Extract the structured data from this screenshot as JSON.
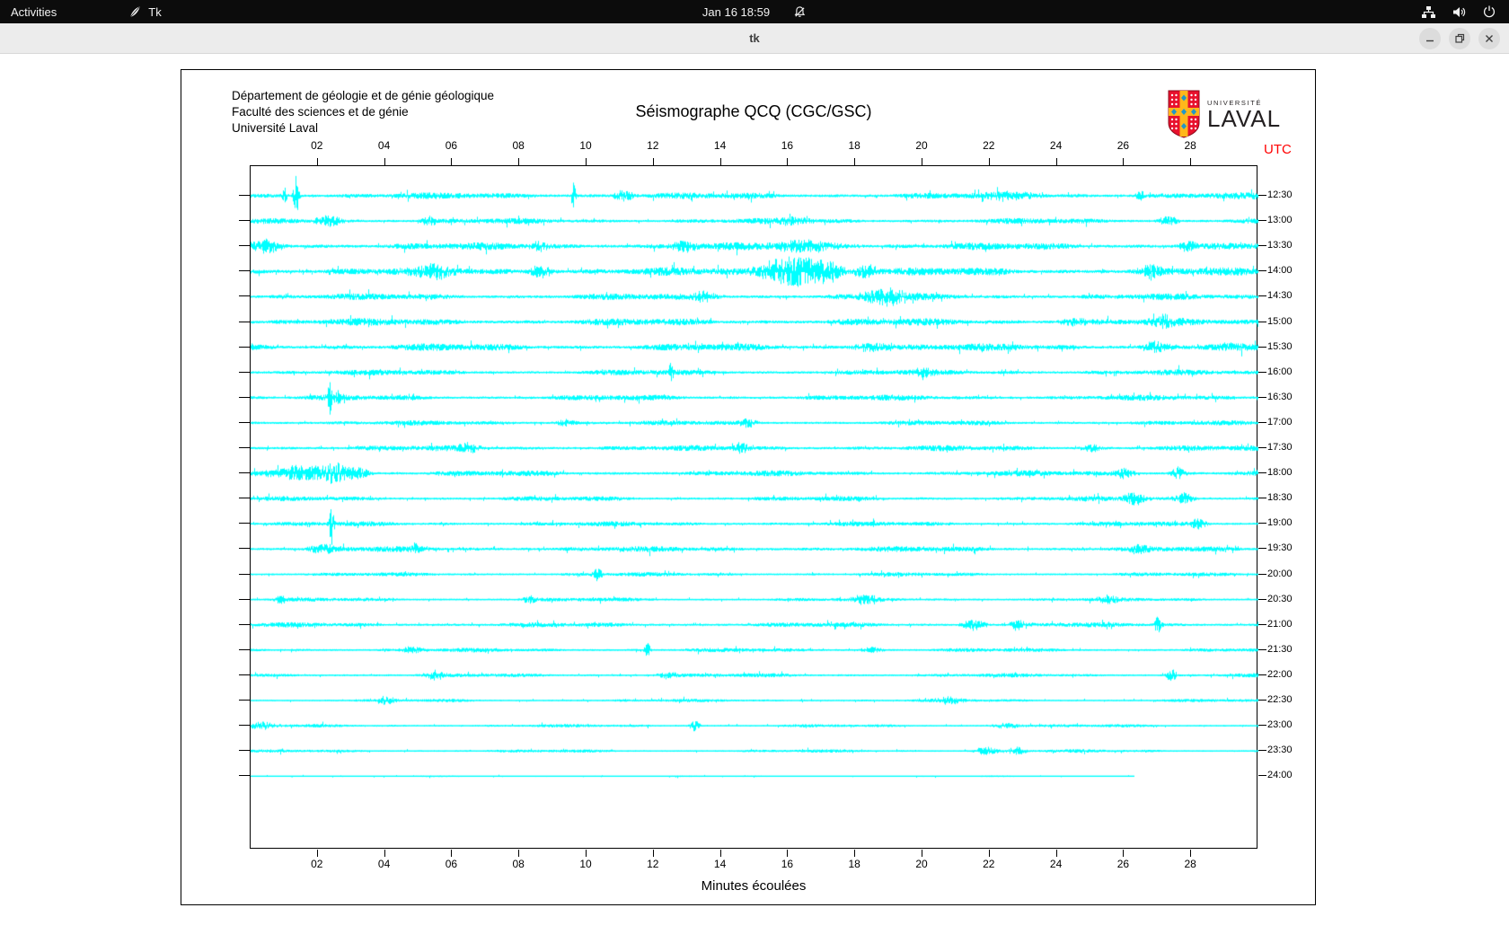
{
  "top_bar": {
    "activities_label": "Activities",
    "app_name": "Tk",
    "clock": "Jan 16 18:59",
    "icons": {
      "app": "tk-feather-icon",
      "notifications": "notifications-disabled-icon",
      "network": "network-wired-icon",
      "volume": "volume-on-icon",
      "power": "power-icon"
    }
  },
  "titlebar": {
    "title": "tk",
    "controls": [
      "minimize",
      "maximize",
      "close"
    ]
  },
  "seismograph": {
    "institution_lines": [
      "Département de géologie et de génie géologique",
      "Faculté des sciences et de génie",
      "Université Laval"
    ],
    "title": "Séismographe QCQ (CGC/GSC)",
    "logo": {
      "small_text": "UNIVERSITÉ",
      "large_text": "LAVAL",
      "shield_red": "#e8112d",
      "shield_gold": "#ffb71b",
      "shield_blue": "#2196c9"
    },
    "utc_label": "UTC",
    "utc_color": "#ff0000",
    "x_axis_label": "Minutes écoulées",
    "minute_ticks": [
      "02",
      "04",
      "06",
      "08",
      "10",
      "12",
      "14",
      "16",
      "18",
      "20",
      "22",
      "24",
      "26",
      "28"
    ],
    "trace_color": "#00ffff",
    "chart_data": {
      "type": "line",
      "x_unit": "minutes",
      "x_range": [
        0,
        30
      ],
      "row_time_labels": [
        "12:30",
        "13:00",
        "13:30",
        "14:00",
        "14:30",
        "15:00",
        "15:30",
        "16:00",
        "16:30",
        "17:00",
        "17:30",
        "18:00",
        "18:30",
        "19:00",
        "19:30",
        "20:00",
        "20:30",
        "21:00",
        "21:30",
        "22:00",
        "22:30",
        "23:00",
        "23:30",
        "24:00"
      ],
      "rows": [
        {
          "time": "12:30",
          "seed": 101,
          "amp": 4.0,
          "end": 30,
          "events": [
            [
              1.34,
              22,
              0.06
            ],
            [
              1.0,
              9,
              0.05
            ],
            [
              9.6,
              15,
              0.05
            ],
            [
              11.1,
              6,
              0.2
            ],
            [
              22.8,
              4,
              0.5
            ],
            [
              26.5,
              5,
              0.12
            ]
          ]
        },
        {
          "time": "13:00",
          "seed": 102,
          "amp": 3.5,
          "end": 30,
          "events": [
            [
              2.3,
              6,
              0.3
            ],
            [
              5.3,
              5,
              0.15
            ],
            [
              16.2,
              4,
              0.3
            ],
            [
              27.3,
              5,
              0.2
            ]
          ]
        },
        {
          "time": "13:30",
          "seed": 103,
          "amp": 4.5,
          "end": 30,
          "events": [
            [
              0.5,
              7,
              0.3
            ],
            [
              8.6,
              5,
              0.2
            ],
            [
              12.9,
              6,
              0.25
            ],
            [
              16.5,
              6,
              0.8
            ],
            [
              27.9,
              6,
              0.2
            ]
          ]
        },
        {
          "time": "14:00",
          "seed": 104,
          "amp": 5.0,
          "end": 30,
          "events": [
            [
              5.5,
              7,
              0.4
            ],
            [
              8.6,
              7,
              0.25
            ],
            [
              15.5,
              8,
              0.4
            ],
            [
              16.3,
              17,
              0.5
            ],
            [
              17.2,
              12,
              0.3
            ],
            [
              18.3,
              8,
              0.25
            ],
            [
              26.8,
              6,
              0.2
            ]
          ]
        },
        {
          "time": "14:30",
          "seed": 105,
          "amp": 4.0,
          "end": 30,
          "events": [
            [
              13.5,
              5,
              0.3
            ],
            [
              18.8,
              8,
              0.4
            ],
            [
              19.3,
              6,
              0.3
            ]
          ]
        },
        {
          "time": "15:00",
          "seed": 106,
          "amp": 4.5,
          "end": 30,
          "events": [
            [
              24.5,
              4,
              0.3
            ],
            [
              27.2,
              6,
              0.25
            ]
          ]
        },
        {
          "time": "15:30",
          "seed": 107,
          "amp": 4.5,
          "end": 30,
          "events": [
            [
              18.5,
              5,
              0.4
            ],
            [
              26.9,
              5,
              0.3
            ]
          ]
        },
        {
          "time": "16:00",
          "seed": 108,
          "amp": 3.5,
          "end": 30,
          "events": [
            [
              12.5,
              11,
              0.05
            ],
            [
              20.0,
              4,
              0.2
            ]
          ]
        },
        {
          "time": "16:30",
          "seed": 109,
          "amp": 3.5,
          "end": 30,
          "events": [
            [
              2.35,
              24,
              0.04
            ],
            [
              2.6,
              7,
              0.1
            ]
          ]
        },
        {
          "time": "17:00",
          "seed": 110,
          "amp": 3.0,
          "end": 30,
          "events": [
            [
              9.4,
              4,
              0.2
            ],
            [
              14.8,
              5,
              0.15
            ]
          ]
        },
        {
          "time": "17:30",
          "seed": 111,
          "amp": 3.5,
          "end": 30,
          "events": [
            [
              6.5,
              5,
              0.25
            ],
            [
              14.6,
              6,
              0.15
            ],
            [
              25.0,
              4,
              0.2
            ]
          ]
        },
        {
          "time": "18:00",
          "seed": 112,
          "amp": 3.5,
          "end": 30,
          "events": [
            [
              1.6,
              8,
              0.7
            ],
            [
              2.6,
              10,
              0.35
            ],
            [
              3.2,
              7,
              0.2
            ],
            [
              26.0,
              6,
              0.25
            ],
            [
              27.6,
              7,
              0.15
            ]
          ]
        },
        {
          "time": "18:30",
          "seed": 113,
          "amp": 3.0,
          "end": 30,
          "events": [
            [
              26.3,
              7,
              0.25
            ],
            [
              27.8,
              6,
              0.2
            ]
          ]
        },
        {
          "time": "19:00",
          "seed": 114,
          "amp": 3.0,
          "end": 30,
          "events": [
            [
              2.4,
              23,
              0.05
            ],
            [
              28.2,
              6,
              0.15
            ]
          ]
        },
        {
          "time": "19:30",
          "seed": 115,
          "amp": 3.5,
          "end": 30,
          "events": [
            [
              2.2,
              5,
              0.3
            ],
            [
              4.9,
              6,
              0.1
            ],
            [
              26.5,
              4,
              0.2
            ]
          ]
        },
        {
          "time": "20:00",
          "seed": 116,
          "amp": 2.5,
          "end": 30,
          "events": [
            [
              10.3,
              8,
              0.1
            ]
          ]
        },
        {
          "time": "20:30",
          "seed": 117,
          "amp": 2.5,
          "end": 30,
          "events": [
            [
              0.9,
              5,
              0.12
            ],
            [
              8.3,
              5,
              0.15
            ],
            [
              18.3,
              5,
              0.25
            ],
            [
              25.5,
              4,
              0.2
            ]
          ]
        },
        {
          "time": "21:00",
          "seed": 118,
          "amp": 3.0,
          "end": 30,
          "events": [
            [
              21.5,
              6,
              0.25
            ],
            [
              22.8,
              6,
              0.15
            ],
            [
              27.0,
              11,
              0.07
            ]
          ]
        },
        {
          "time": "21:30",
          "seed": 119,
          "amp": 2.5,
          "end": 30,
          "events": [
            [
              4.8,
              4,
              0.2
            ],
            [
              11.8,
              9,
              0.06
            ],
            [
              18.5,
              4,
              0.2
            ]
          ]
        },
        {
          "time": "22:00",
          "seed": 120,
          "amp": 2.5,
          "end": 30,
          "events": [
            [
              5.5,
              5,
              0.15
            ],
            [
              12.4,
              4,
              0.2
            ],
            [
              27.4,
              8,
              0.1
            ]
          ]
        },
        {
          "time": "22:30",
          "seed": 121,
          "amp": 2.0,
          "end": 30,
          "events": [
            [
              4.0,
              4,
              0.2
            ],
            [
              20.8,
              4,
              0.25
            ]
          ]
        },
        {
          "time": "23:00",
          "seed": 122,
          "amp": 2.0,
          "end": 30,
          "events": [
            [
              0.3,
              4,
              0.3
            ],
            [
              13.2,
              7,
              0.1
            ],
            [
              22.5,
              3,
              0.3
            ]
          ]
        },
        {
          "time": "23:30",
          "seed": 123,
          "amp": 2.0,
          "end": 30,
          "events": [
            [
              21.9,
              5,
              0.25
            ],
            [
              22.8,
              4,
              0.2
            ]
          ]
        },
        {
          "time": "24:00",
          "seed": 124,
          "amp": 1.0,
          "end": 26.3,
          "events": []
        }
      ]
    }
  }
}
